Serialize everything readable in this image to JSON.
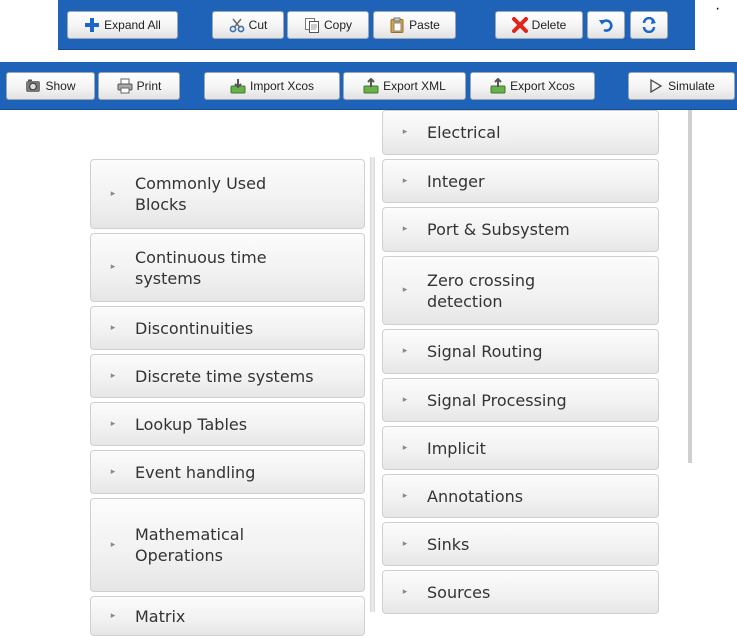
{
  "toolbar1": {
    "buttons": [
      {
        "label": "Expand All",
        "icon": "plus-icon"
      },
      {
        "label": "Cut",
        "icon": "scissors-icon"
      },
      {
        "label": "Copy",
        "icon": "copy-icon"
      },
      {
        "label": "Paste",
        "icon": "clipboard-icon"
      },
      {
        "label": "Delete",
        "icon": "delete-x-icon"
      },
      {
        "label": "",
        "icon": "undo-icon"
      },
      {
        "label": "",
        "icon": "redo-icon"
      }
    ]
  },
  "toolbar2": {
    "buttons": [
      {
        "label": "Show",
        "icon": "show-icon"
      },
      {
        "label": "Print",
        "icon": "printer-icon"
      },
      {
        "label": "Import Xcos",
        "icon": "import-icon"
      },
      {
        "label": "Export XML",
        "icon": "export-icon"
      },
      {
        "label": "Export Xcos",
        "icon": "export-icon"
      },
      {
        "label": "Simulate",
        "icon": "play-icon"
      }
    ]
  },
  "palette_left": [
    "Commonly Used\nBlocks",
    "Continuous time\nsystems",
    "Discontinuities",
    "Discrete time systems",
    "Lookup Tables",
    "Event handling",
    "Mathematical\nOperations",
    "Matrix"
  ],
  "palette_right": [
    "Electrical",
    "Integer",
    "Port & Subsystem",
    "Zero crossing\ndetection",
    "Signal Routing",
    "Signal Processing",
    "Implicit",
    "Annotations",
    "Sinks",
    "Sources"
  ],
  "colors": {
    "toolbar_bg": "#1e63b8",
    "accent_red": "#e2231a",
    "accent_blue": "#1a66c9"
  }
}
